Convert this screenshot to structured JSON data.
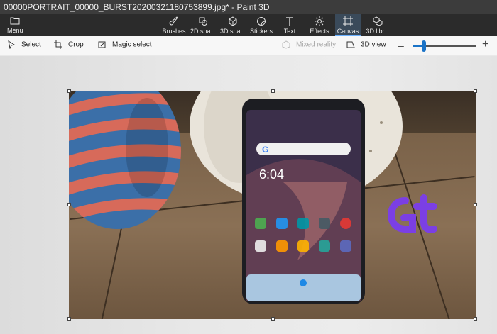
{
  "window": {
    "title": "00000PORTRAIT_00000_BURST20200321180753899.jpg* - Paint 3D"
  },
  "toolbar": {
    "menu_label": "Menu",
    "tools": [
      {
        "id": "brushes",
        "label": "Brushes",
        "icon": "brush-icon"
      },
      {
        "id": "shapes2d",
        "label": "2D sha...",
        "icon": "2d-shapes-icon"
      },
      {
        "id": "shapes3d",
        "label": "3D sha...",
        "icon": "3d-shapes-icon"
      },
      {
        "id": "stickers",
        "label": "Stickers",
        "icon": "sticker-icon"
      },
      {
        "id": "text",
        "label": "Text",
        "icon": "text-icon"
      },
      {
        "id": "effects",
        "label": "Effects",
        "icon": "effects-icon"
      },
      {
        "id": "canvas",
        "label": "Canvas",
        "icon": "canvas-icon",
        "active": true
      },
      {
        "id": "library3d",
        "label": "3D libr...",
        "icon": "3d-library-icon"
      }
    ]
  },
  "subbar": {
    "select_label": "Select",
    "crop_label": "Crop",
    "magic_select_label": "Magic select",
    "mixed_reality_label": "Mixed reality",
    "view3d_label": "3D view",
    "zoom_level": 0.17
  },
  "colors": {
    "accent": "#1a73c7",
    "titlebar": "#3c3c3c",
    "toolbar": "#2b2b2b"
  }
}
